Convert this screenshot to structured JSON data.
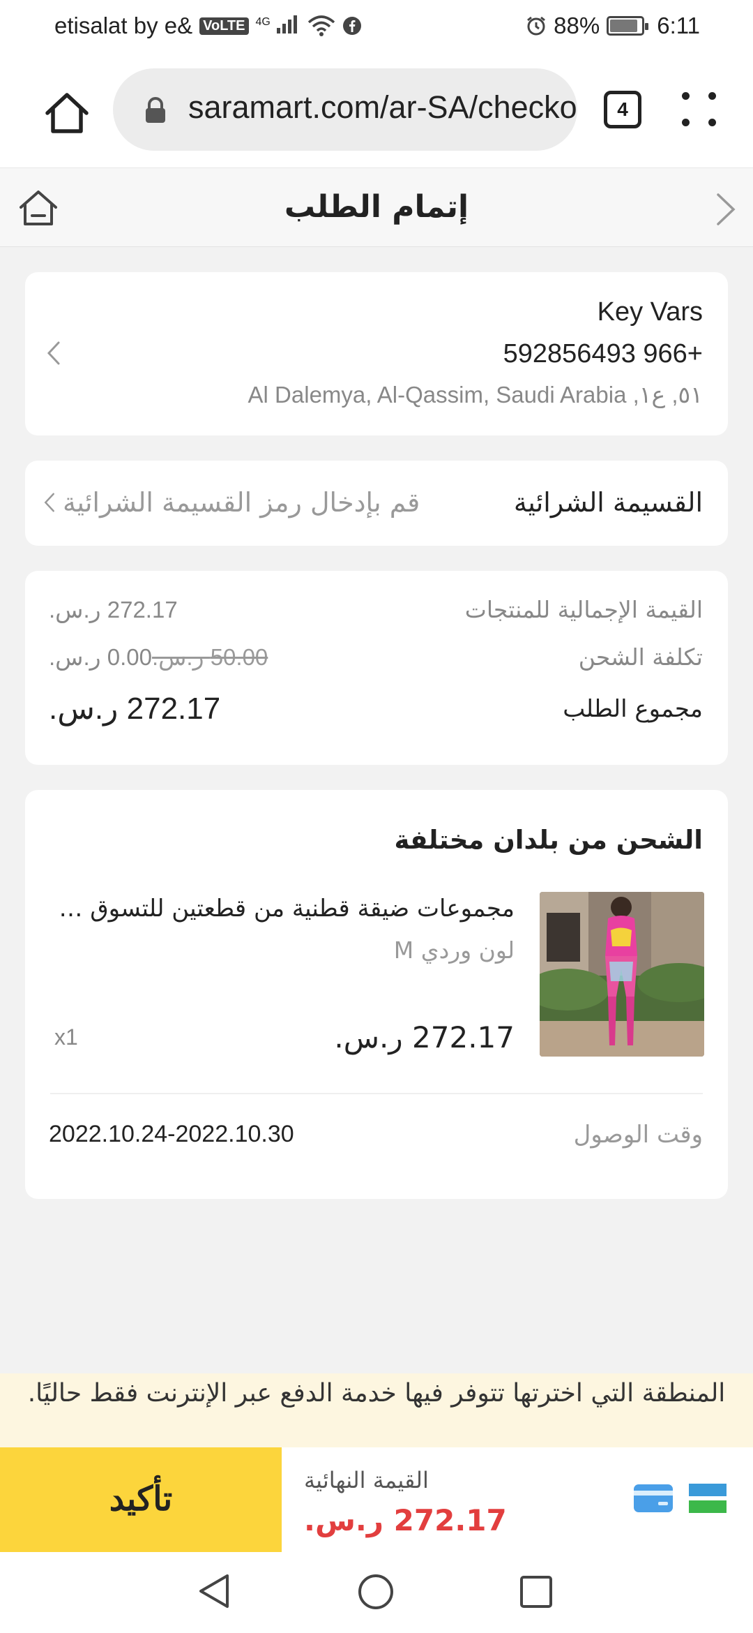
{
  "status_bar": {
    "carrier": "etisalat by e&",
    "volte": "VoLTE",
    "network": "4G",
    "battery": "88%",
    "battery_level": 0.88,
    "time": "6:11"
  },
  "browser": {
    "url": "saramart.com/ar-SA/checkout",
    "tab_count": "4"
  },
  "page": {
    "title": "إتمام الطلب"
  },
  "address": {
    "name": "Key Vars",
    "phone": "592856493 966+",
    "line": "Al Dalemya, Al-Qassim, Saudi Arabia ,٥١, ع١"
  },
  "coupon": {
    "label": "القسيمة الشرائية",
    "placeholder": "قم بإدخال رمز القسيمة الشرائية"
  },
  "summary": {
    "subtotal_label": "القيمة الإجمالية للمنتجات",
    "subtotal_value": "272.17 ر.س.",
    "shipping_label": "تكلفة الشحن",
    "shipping_original": "50.00 ر.س.",
    "shipping_value": "0.00 ر.س.",
    "total_label": "مجموع الطلب",
    "total_value": "272.17 ر.س."
  },
  "shipment": {
    "title": "الشحن من بلدان مختلفة",
    "product_name": "مجموعات ضيقة قطنية من قطعتين للتسوق وقت الفراغ",
    "product_variant": "لون وردي M",
    "product_price": "272.17 ر.س.",
    "product_qty": "x1",
    "arrival_label": "وقت الوصول",
    "arrival_value": "2022.10.24-2022.10.30"
  },
  "notice": {
    "text": "المنطقة التي اخترتها تتوفر فيها خدمة الدفع عبر الإنترنت فقط حاليًا."
  },
  "checkout": {
    "confirm_label": "تأكيد",
    "final_label": "القيمة النهائية",
    "final_value": "272.17 ر.س."
  },
  "colors": {
    "accent_yellow": "#fcd53c",
    "price_red": "#e23e3e",
    "notice_bg": "#fdf6e0"
  }
}
